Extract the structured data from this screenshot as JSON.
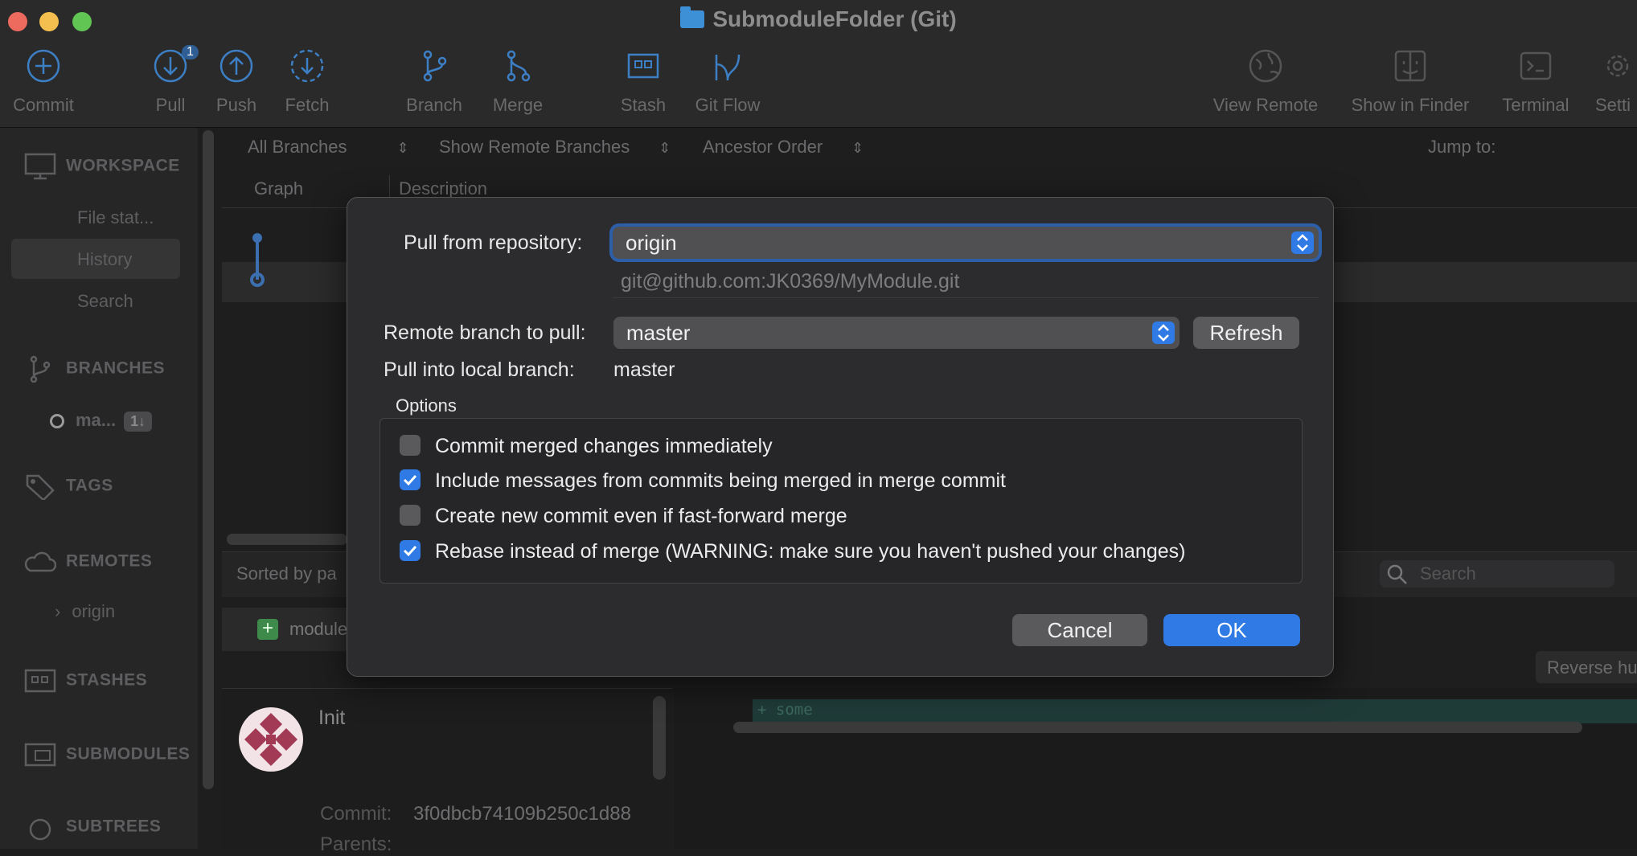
{
  "window": {
    "title": "SubmoduleFolder (Git)",
    "colors": {
      "close": "#ed6a5e",
      "minimize": "#f5bf4f",
      "zoom": "#61c554"
    }
  },
  "toolbar": {
    "commit": "Commit",
    "pull": "Pull",
    "pull_badge": "1",
    "push": "Push",
    "fetch": "Fetch",
    "branch": "Branch",
    "merge": "Merge",
    "stash": "Stash",
    "gitflow": "Git Flow",
    "view_remote": "View Remote",
    "show_in_finder": "Show in Finder",
    "terminal": "Terminal",
    "settings": "Setti"
  },
  "sidebar": {
    "workspace": "WORKSPACE",
    "file_status": "File stat...",
    "history": "History",
    "search": "Search",
    "branches": "BRANCHES",
    "branch_item": "ma...",
    "branch_badge": "1↓",
    "tags": "TAGS",
    "remotes": "REMOTES",
    "remote_origin": "origin",
    "stashes": "STASHES",
    "submodules": "SUBMODULES",
    "subtrees": "SUBTREES"
  },
  "main": {
    "filter_branches": "All Branches",
    "filter_remote": "Show Remote Branches",
    "filter_order": "Ancestor Order",
    "jump_to": "Jump to:",
    "col_graph": "Graph",
    "col_description": "Description",
    "sorted_by": "Sorted by pa",
    "search_placeholder": "Search",
    "file_name": "module",
    "reverse_btn": "Reverse hu",
    "commit_msg": "Init",
    "commit_label": "Commit:",
    "commit_hash": "3f0dbcb74109b250c1d88",
    "parents_label": "Parents:",
    "diff_line": "+ some"
  },
  "dialog": {
    "pull_from_label": "Pull from repository:",
    "repository": "origin",
    "repo_url": "git@github.com:JK0369/MyModule.git",
    "remote_branch_label": "Remote branch to pull:",
    "remote_branch": "master",
    "refresh": "Refresh",
    "local_branch_label": "Pull into local branch:",
    "local_branch": "master",
    "options_title": "Options",
    "options": [
      {
        "label": "Commit merged changes immediately",
        "checked": false
      },
      {
        "label": "Include messages from commits being merged in merge commit",
        "checked": true
      },
      {
        "label": "Create new commit even if fast-forward merge",
        "checked": false
      },
      {
        "label": "Rebase instead of merge (WARNING: make sure you haven't pushed your changes)",
        "checked": true
      }
    ],
    "cancel": "Cancel",
    "ok": "OK",
    "accent_color": "#2f7ae5"
  }
}
